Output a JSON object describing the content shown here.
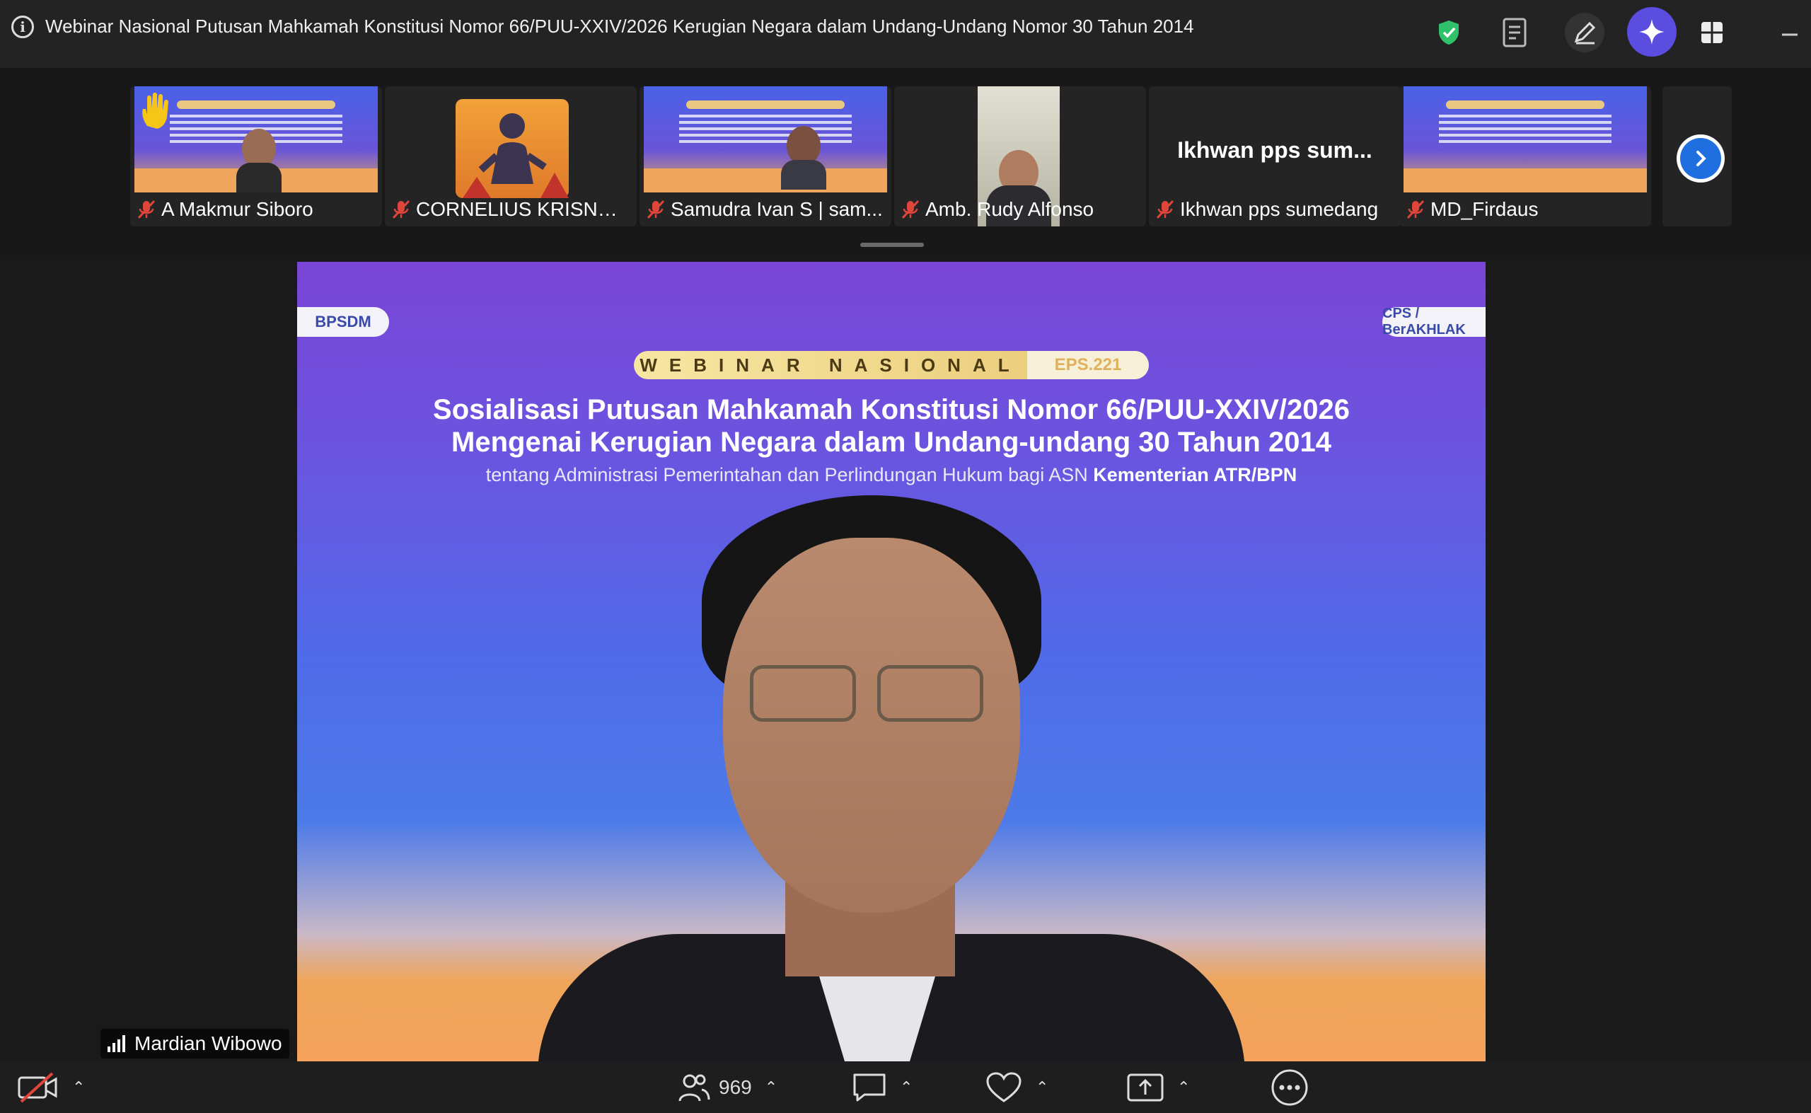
{
  "window": {
    "title": "Webinar Nasional Putusan Mahkamah Konstitusi Nomor 66/PUU-XXIV/2026 Kerugian Negara dalam Undang-Undang Nomor 30 Tahun 2014"
  },
  "participants": [
    {
      "name": "A Makmur Siboro"
    },
    {
      "name": "CORNELIUS KRISNA_ ..."
    },
    {
      "name": "Samudra Ivan S | sam..."
    },
    {
      "name": "Amb. Rudy Alfonso"
    },
    {
      "name": "Ikhwan pps sumedang",
      "display": "Ikhwan pps sum..."
    },
    {
      "name": "MD_Firdaus"
    }
  ],
  "slide": {
    "logo_left": "BPSDM",
    "logo_right": "CPS / BerAKHLAK",
    "badge": "WEBINAR NASIONAL",
    "episode": "EPS.221",
    "title_line1": "Sosialisasi Putusan Mahkamah Konstitusi Nomor 66/PUU-XXIV/2026",
    "title_line2": "Mengenai Kerugian Negara dalam Undang-undang 30 Tahun 2014",
    "subtitle": "tentang Administrasi Pemerintahan dan Perlindungan Hukum bagi ASN",
    "subtitle_bold": "Kementerian ATR/BPN"
  },
  "active_speaker": {
    "name": "Mardian Wibowo"
  },
  "toolbar": {
    "participant_count": "969"
  },
  "colors": {
    "accent_blue": "#1f6fe0",
    "shield_green": "#2fc26a",
    "mic_off_red": "#e0453a",
    "ai_purple": "#5a4de0"
  }
}
